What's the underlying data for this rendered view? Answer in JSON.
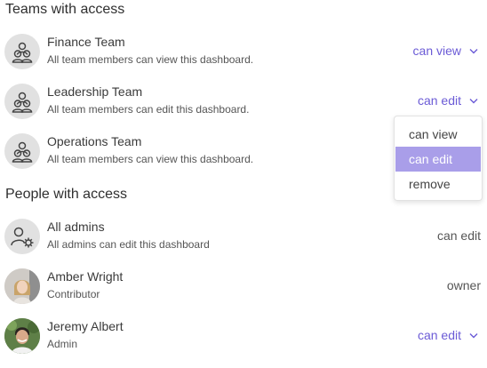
{
  "teams_section": {
    "title": "Teams with access",
    "items": [
      {
        "name": "Finance Team",
        "desc": "All team members can view this dashboard.",
        "permission": "can view"
      },
      {
        "name": "Leadership Team",
        "desc": "All team members can edit this dashboard.",
        "permission": "can edit"
      },
      {
        "name": "Operations Team",
        "desc": "All team members can view this dashboard.",
        "permission": ""
      }
    ]
  },
  "people_section": {
    "title": "People with access",
    "items": [
      {
        "name": "All admins",
        "desc": "All admins can edit this dashboard",
        "permission": "can edit"
      },
      {
        "name": "Amber Wright",
        "desc": "Contributor",
        "permission": "owner"
      },
      {
        "name": "Jeremy Albert",
        "desc": "Admin",
        "permission": "can edit"
      }
    ]
  },
  "dropdown": {
    "options": [
      "can view",
      "can edit",
      "remove"
    ],
    "selected": "can edit"
  },
  "colors": {
    "accent": "#6b5bd6",
    "selected_bg": "#a99ee9",
    "avatar_bg": "#e1e1e1"
  },
  "icons": {
    "team": "team-icon",
    "admin": "admin-gear-icon",
    "chevron": "chevron-down-icon"
  }
}
